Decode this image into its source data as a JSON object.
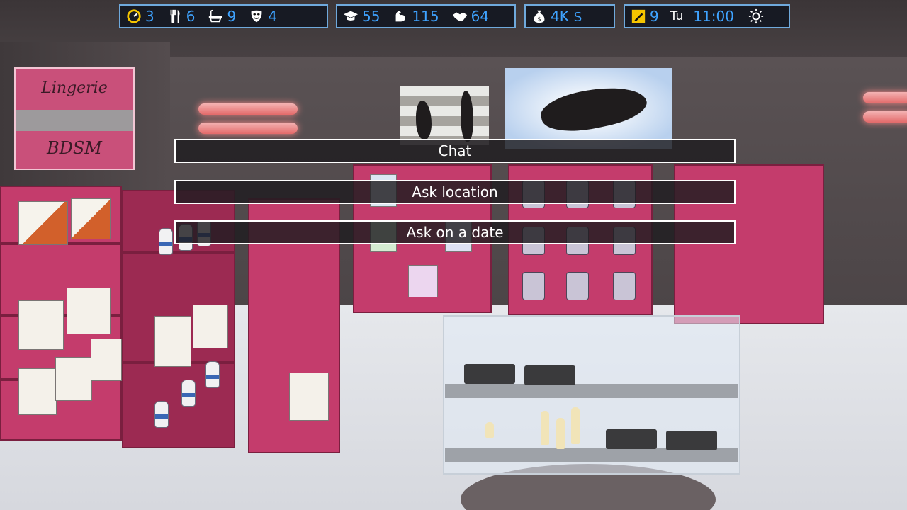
{
  "hud": {
    "needs": [
      {
        "icon": "energy-gauge-icon",
        "value": "3"
      },
      {
        "icon": "fork-knife-icon",
        "value": "6"
      },
      {
        "icon": "bathtub-icon",
        "value": "9"
      },
      {
        "icon": "mask-icon",
        "value": "4"
      }
    ],
    "skills": [
      {
        "icon": "graduation-cap-icon",
        "value": "55"
      },
      {
        "icon": "strength-arm-icon",
        "value": "115"
      },
      {
        "icon": "handshake-icon",
        "value": "64"
      }
    ],
    "money": {
      "icon": "money-bag-icon",
      "value": "4K $"
    },
    "time": {
      "icon": "pencil-note-icon",
      "date": "9",
      "weekday": "Tu",
      "clock": "11:00",
      "weather_icon": "sun-icon"
    }
  },
  "scene": {
    "sign_line1": "Lingerie",
    "sign_line2": "BDSM"
  },
  "menu": {
    "options": [
      "Chat",
      "Ask location",
      "Ask on a date"
    ]
  },
  "colors": {
    "hud_border": "#6fa9dc",
    "hud_value": "#3fa3ff",
    "shelf_pink": "#c43c6c"
  }
}
